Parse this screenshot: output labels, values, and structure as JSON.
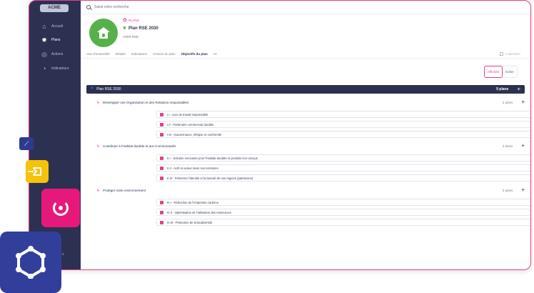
{
  "app": {
    "logo": "ACME"
  },
  "sidebar": {
    "items": [
      {
        "label": "Accueil",
        "icon": "home-icon"
      },
      {
        "label": "Plans",
        "icon": "gear-icon"
      },
      {
        "label": "Actions",
        "icon": "target-icon"
      },
      {
        "label": "Indicateurs",
        "icon": "gauge-icon"
      }
    ],
    "active": "Plans",
    "footer": "x"
  },
  "search": {
    "placeholder": "Saisir votre recherche"
  },
  "plan": {
    "tag": "PLANS",
    "title": "Plan RSE 2030",
    "owner": "ATER RSE",
    "avatar_color": "#56b14a"
  },
  "tabs": {
    "items": [
      "Vue d'ensemble",
      "Détails",
      "Indicateurs",
      "Actions du plan",
      "Objectifs du plan",
      "•••"
    ],
    "active": "Objectifs du plan",
    "right_label": "Calendrier"
  },
  "view_toggle": {
    "options": [
      "Affichée",
      "Éditer"
    ],
    "active": "Affichée"
  },
  "tree": {
    "root": {
      "label": "Plan RSE 2030",
      "count": "9 plans"
    },
    "groups": [
      {
        "label": "Développer une Organisation et des Relations responsables",
        "count": "3 plans",
        "items": [
          "I.I - Lieu de travail responsable",
          "I.II - Partenaire commercial durable",
          "I.III - Gouvernance, éthique et conformité"
        ]
      },
      {
        "label": "Contribuer à l'Habitat durable et aux Communautés",
        "count": "3 plans",
        "items": [
          "II.I - Solution innovante pour l'Habitat durable et produits éco-conçus",
          "II.II - Actif et acteur dans nos territoires",
          "II.III - Préserver l'identité et la beauté de nos régions (patrimoine)"
        ]
      },
      {
        "label": "Protéger notre environnement",
        "count": "3 plans",
        "items": [
          "III.I - Réduction de l'empreinte carbone",
          "III.II - Optimisation de l'utilisation des ressources",
          "III.III - Protection de la biodiversité"
        ]
      }
    ]
  },
  "colors": {
    "brand": "#e83e8c",
    "navy": "#2c3152",
    "green": "#56b14a",
    "yellow": "#f6c20a",
    "blue": "#323f9a"
  }
}
